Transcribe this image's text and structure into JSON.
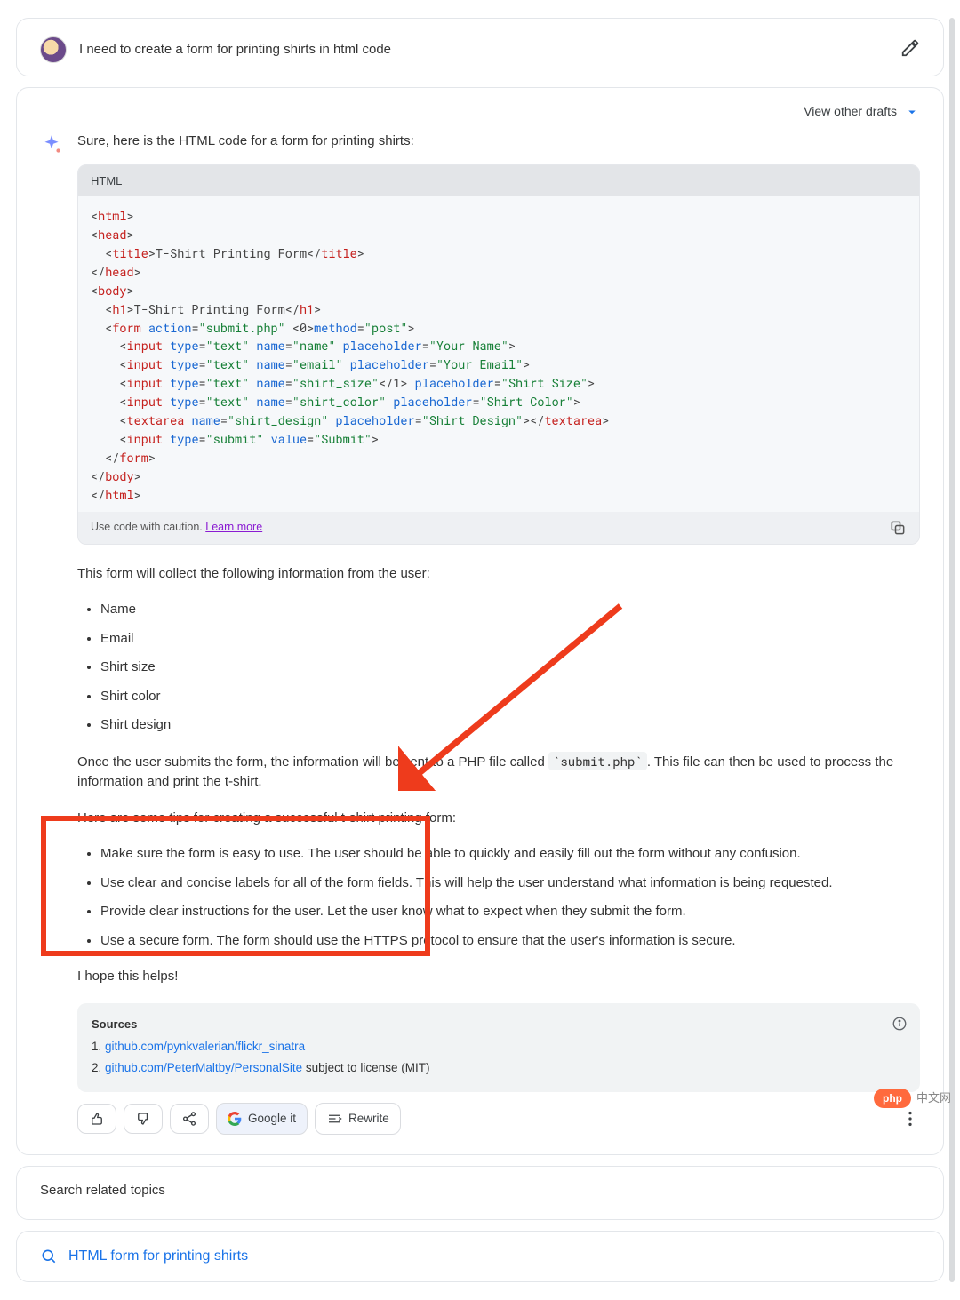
{
  "prompt": "I need to create a form for printing shirts in html code",
  "drafts_label": "View other drafts",
  "intro": "Sure, here is the HTML code for a form for printing shirts:",
  "code": {
    "lang_label": "HTML",
    "caution": "Use code with caution.",
    "learn_more": "Learn more",
    "tokens": [
      [
        "wh",
        "<"
      ],
      [
        "tag",
        "html"
      ],
      [
        "wh",
        ">\n<"
      ],
      [
        "tag",
        "head"
      ],
      [
        "wh",
        ">\n  <"
      ],
      [
        "tag",
        "title"
      ],
      [
        "wh",
        ">T-Shirt Printing Form</"
      ],
      [
        "tag",
        "title"
      ],
      [
        "wh",
        ">\n</"
      ],
      [
        "tag",
        "head"
      ],
      [
        "wh",
        ">\n<"
      ],
      [
        "tag",
        "body"
      ],
      [
        "wh",
        ">\n  <"
      ],
      [
        "tag",
        "h1"
      ],
      [
        "wh",
        ">T-Shirt Printing Form</"
      ],
      [
        "tag",
        "h1"
      ],
      [
        "wh",
        ">\n  <"
      ],
      [
        "tag",
        "form"
      ],
      [
        "wh",
        " "
      ],
      [
        "attr",
        "action"
      ],
      [
        "wh",
        "="
      ],
      [
        "val",
        "\"submit.php\""
      ],
      [
        "wh",
        " <0>"
      ],
      [
        "attr",
        "method"
      ],
      [
        "wh",
        "="
      ],
      [
        "val",
        "\"post\""
      ],
      [
        "wh",
        ">\n    <"
      ],
      [
        "tag",
        "input"
      ],
      [
        "wh",
        " "
      ],
      [
        "attr",
        "type"
      ],
      [
        "wh",
        "="
      ],
      [
        "val",
        "\"text\""
      ],
      [
        "wh",
        " "
      ],
      [
        "attr",
        "name"
      ],
      [
        "wh",
        "="
      ],
      [
        "val",
        "\"name\""
      ],
      [
        "wh",
        " "
      ],
      [
        "attr",
        "placeholder"
      ],
      [
        "wh",
        "="
      ],
      [
        "val",
        "\"Your Name\""
      ],
      [
        "wh",
        ">\n    <"
      ],
      [
        "tag",
        "input"
      ],
      [
        "wh",
        " "
      ],
      [
        "attr",
        "type"
      ],
      [
        "wh",
        "="
      ],
      [
        "val",
        "\"text\""
      ],
      [
        "wh",
        " "
      ],
      [
        "attr",
        "name"
      ],
      [
        "wh",
        "="
      ],
      [
        "val",
        "\"email\""
      ],
      [
        "wh",
        " "
      ],
      [
        "attr",
        "placeholder"
      ],
      [
        "wh",
        "="
      ],
      [
        "val",
        "\"Your Email\""
      ],
      [
        "wh",
        ">\n    <"
      ],
      [
        "tag",
        "input"
      ],
      [
        "wh",
        " "
      ],
      [
        "attr",
        "type"
      ],
      [
        "wh",
        "="
      ],
      [
        "val",
        "\"text\""
      ],
      [
        "wh",
        " "
      ],
      [
        "attr",
        "name"
      ],
      [
        "wh",
        "="
      ],
      [
        "val",
        "\"shirt_size\""
      ],
      [
        "wh",
        "</1> "
      ],
      [
        "attr",
        "placeholder"
      ],
      [
        "wh",
        "="
      ],
      [
        "val",
        "\"Shirt Size\""
      ],
      [
        "wh",
        ">\n    <"
      ],
      [
        "tag",
        "input"
      ],
      [
        "wh",
        " "
      ],
      [
        "attr",
        "type"
      ],
      [
        "wh",
        "="
      ],
      [
        "val",
        "\"text\""
      ],
      [
        "wh",
        " "
      ],
      [
        "attr",
        "name"
      ],
      [
        "wh",
        "="
      ],
      [
        "val",
        "\"shirt_color\""
      ],
      [
        "wh",
        " "
      ],
      [
        "attr",
        "placeholder"
      ],
      [
        "wh",
        "="
      ],
      [
        "val",
        "\"Shirt Color\""
      ],
      [
        "wh",
        ">\n    <"
      ],
      [
        "tag",
        "textarea"
      ],
      [
        "wh",
        " "
      ],
      [
        "attr",
        "name"
      ],
      [
        "wh",
        "="
      ],
      [
        "val",
        "\"shirt_design\""
      ],
      [
        "wh",
        " "
      ],
      [
        "attr",
        "placeholder"
      ],
      [
        "wh",
        "="
      ],
      [
        "val",
        "\"Shirt Design\""
      ],
      [
        "wh",
        "></"
      ],
      [
        "tag",
        "textarea"
      ],
      [
        "wh",
        ">\n    <"
      ],
      [
        "tag",
        "input"
      ],
      [
        "wh",
        " "
      ],
      [
        "attr",
        "type"
      ],
      [
        "wh",
        "="
      ],
      [
        "val",
        "\"submit\""
      ],
      [
        "wh",
        " "
      ],
      [
        "attr",
        "value"
      ],
      [
        "wh",
        "="
      ],
      [
        "val",
        "\"Submit\""
      ],
      [
        "wh",
        ">\n  </"
      ],
      [
        "tag",
        "form"
      ],
      [
        "wh",
        ">\n</"
      ],
      [
        "tag",
        "body"
      ],
      [
        "wh",
        ">\n</"
      ],
      [
        "tag",
        "html"
      ],
      [
        "wh",
        ">"
      ]
    ]
  },
  "after_code": "This form will collect the following information from the user:",
  "fields": [
    "Name",
    "Email",
    "Shirt size",
    "Shirt color",
    "Shirt design"
  ],
  "explain_before_mono": "Once the user submits the form, the information will be sent to a PHP file called ",
  "explain_mono": "`submit.php`",
  "explain_after_mono": ". This file can then be used to process the information and print the t-shirt.",
  "tips_intro": "Here are some tips for creating a successful t-shirt printing form:",
  "tips": [
    "Make sure the form is easy to use. The user should be able to quickly and easily fill out the form without any confusion.",
    "Use clear and concise labels for all of the form fields. This will help the user understand what information is being requested.",
    "Provide clear instructions for the user. Let the user know what to expect when they submit the form.",
    "Use a secure form. The form should use the HTTPS protocol to ensure that the user's information is secure."
  ],
  "closing": "I hope this helps!",
  "sources": {
    "title": "Sources",
    "items": [
      {
        "num": "1.",
        "url": "github.com/pynkvalerian/flickr_sinatra",
        "suffix": ""
      },
      {
        "num": "2.",
        "url": "github.com/PeterMaltby/PersonalSite",
        "suffix": " subject to license (MIT)"
      }
    ]
  },
  "actions": {
    "google_it": "Google it",
    "rewrite": "Rewrite"
  },
  "related": {
    "title": "Search related topics",
    "item": "HTML form for printing shirts"
  },
  "watermark": {
    "pill": "php",
    "text": "中文网"
  }
}
